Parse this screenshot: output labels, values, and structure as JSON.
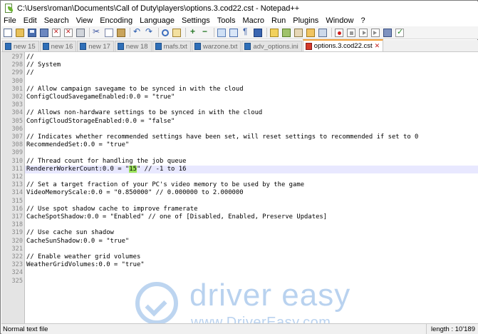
{
  "window": {
    "title": "C:\\Users\\roman\\Documents\\Call of Duty\\players\\options.3.cod22.cst - Notepad++"
  },
  "menu": [
    "File",
    "Edit",
    "Search",
    "View",
    "Encoding",
    "Language",
    "Settings",
    "Tools",
    "Macro",
    "Run",
    "Plugins",
    "Window",
    "?"
  ],
  "toolbar_icons": [
    "new-file-icon",
    "open-file-icon",
    "save-icon",
    "save-all-icon",
    "close-icon",
    "close-all-icon",
    "print-icon",
    "cut-icon",
    "copy-icon",
    "paste-icon",
    "undo-icon",
    "redo-icon",
    "find-icon",
    "replace-icon",
    "zoom-in-icon",
    "zoom-out-icon",
    "sync-scroll-icon",
    "word-wrap-icon",
    "show-all-characters-icon",
    "indent-guide-icon",
    "user-defined-language-icon",
    "document-map-icon",
    "function-list-icon",
    "folder-as-workspace-icon",
    "monitoring-icon",
    "record-macro-icon",
    "stop-macro-icon",
    "play-macro-icon",
    "run-macro-multiple-icon",
    "save-macro-icon",
    "spell-check-icon"
  ],
  "tabs": [
    {
      "label": "new 15",
      "active": false
    },
    {
      "label": "new 16",
      "active": false
    },
    {
      "label": "new 17",
      "active": false
    },
    {
      "label": "new 18",
      "active": false
    },
    {
      "label": "mafs.txt",
      "active": false
    },
    {
      "label": "warzone.txt",
      "active": false
    },
    {
      "label": "adv_options.ini",
      "active": false
    },
    {
      "label": "options.3.cod22.cst",
      "active": true
    }
  ],
  "editor": {
    "current_line": "311",
    "lines": [
      {
        "num": "297",
        "text": "//"
      },
      {
        "num": "298",
        "text": "// System"
      },
      {
        "num": "299",
        "text": "//"
      },
      {
        "num": "300",
        "text": ""
      },
      {
        "num": "301",
        "text": "// Allow campaign savegame to be synced in with the cloud"
      },
      {
        "num": "302",
        "text": "ConfigCloudSavegameEnabled:0.0 = \"true\""
      },
      {
        "num": "303",
        "text": ""
      },
      {
        "num": "304",
        "text": "// Allows non-hardware settings to be synced in with the cloud"
      },
      {
        "num": "305",
        "text": "ConfigCloudStorageEnabled:0.0 = \"false\""
      },
      {
        "num": "306",
        "text": ""
      },
      {
        "num": "307",
        "text": "// Indicates whether recommended settings have been set, will reset settings to recommended if set to 0"
      },
      {
        "num": "308",
        "text": "RecommendedSet:0.0 = \"true\""
      },
      {
        "num": "309",
        "text": ""
      },
      {
        "num": "310",
        "text": "// Thread count for handling the job queue"
      },
      {
        "num": "311",
        "text_before": "RendererWorkerCount:0.0 = \"",
        "text_highlight": "15",
        "text_after": "\" // -1 to 16"
      },
      {
        "num": "312",
        "text": ""
      },
      {
        "num": "313",
        "text": "// Set a target fraction of your PC's video memory to be used by the game"
      },
      {
        "num": "314",
        "text": "VideoMemoryScale:0.0 = \"0.850000\" // 0.000000 to 2.000000"
      },
      {
        "num": "315",
        "text": ""
      },
      {
        "num": "316",
        "text": "// Use spot shadow cache to improve framerate"
      },
      {
        "num": "317",
        "text": "CacheSpotShadow:0.0 = \"Enabled\" // one of [Disabled, Enabled, Preserve Updates]"
      },
      {
        "num": "318",
        "text": ""
      },
      {
        "num": "319",
        "text": "// Use cache sun shadow"
      },
      {
        "num": "320",
        "text": "CacheSunShadow:0.0 = \"true\""
      },
      {
        "num": "321",
        "text": ""
      },
      {
        "num": "322",
        "text": "// Enable weather grid volumes"
      },
      {
        "num": "323",
        "text": "WeatherGridVolumes:0.0 = \"true\""
      },
      {
        "num": "324",
        "text": ""
      },
      {
        "num": "325",
        "text": ""
      }
    ]
  },
  "watermark": {
    "brand": "driver easy",
    "url": "www.DriverEasy.com"
  },
  "status": {
    "file_type": "Normal text file",
    "length": "length : 10'189"
  }
}
